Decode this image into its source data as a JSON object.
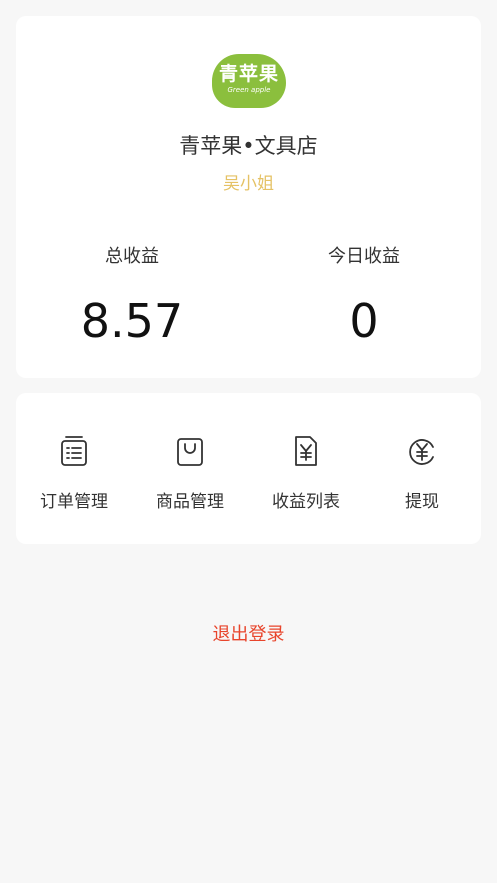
{
  "profile": {
    "logo_text": "青苹果",
    "logo_subtext": "Green apple",
    "shop_name": "青苹果•文具店",
    "owner_name": "吴小姐"
  },
  "stats": {
    "total": {
      "label": "总收益",
      "value": "8.57"
    },
    "today": {
      "label": "今日收益",
      "value": "0"
    }
  },
  "menu": [
    {
      "label": "订单管理",
      "icon": "order-list-icon"
    },
    {
      "label": "商品管理",
      "icon": "shopping-bag-icon"
    },
    {
      "label": "收益列表",
      "icon": "earnings-document-icon"
    },
    {
      "label": "提现",
      "icon": "withdraw-yen-icon"
    }
  ],
  "logout_label": "退出登录",
  "colors": {
    "accent_gold": "#e5c265",
    "logout_red": "#e8452c",
    "logo_green": "#8bbf3d"
  }
}
